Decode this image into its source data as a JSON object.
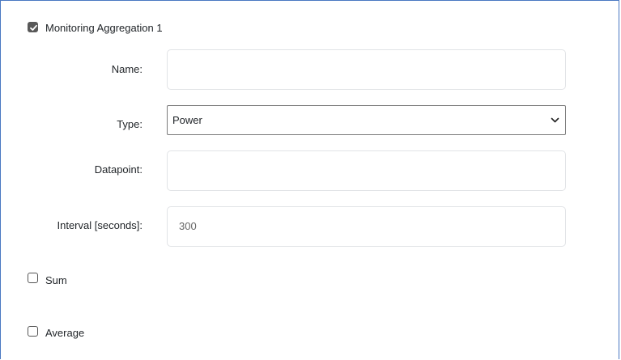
{
  "aggregation": {
    "enabled_label": "Monitoring Aggregation 1",
    "enabled": true
  },
  "fields": {
    "name": {
      "label": "Name:",
      "value": ""
    },
    "type": {
      "label": "Type:",
      "selected": "Power"
    },
    "datapoint": {
      "label": "Datapoint:",
      "value": ""
    },
    "interval": {
      "label": "Interval [seconds]:",
      "value": "300"
    }
  },
  "options": {
    "sum": {
      "label": "Sum",
      "checked": false
    },
    "average": {
      "label": "Average",
      "checked": false
    }
  },
  "colors": {
    "frame_border": "#4a78c2",
    "checked_box": "#595959",
    "input_border": "#e1e3e6",
    "select_border": "#7a7a7a"
  },
  "icons": {
    "enabled_checkbox": "checkbox-checked-icon",
    "select_arrow": "chevron-down-icon",
    "sum_checkbox": "checkbox-unchecked-icon",
    "average_checkbox": "checkbox-unchecked-icon"
  }
}
